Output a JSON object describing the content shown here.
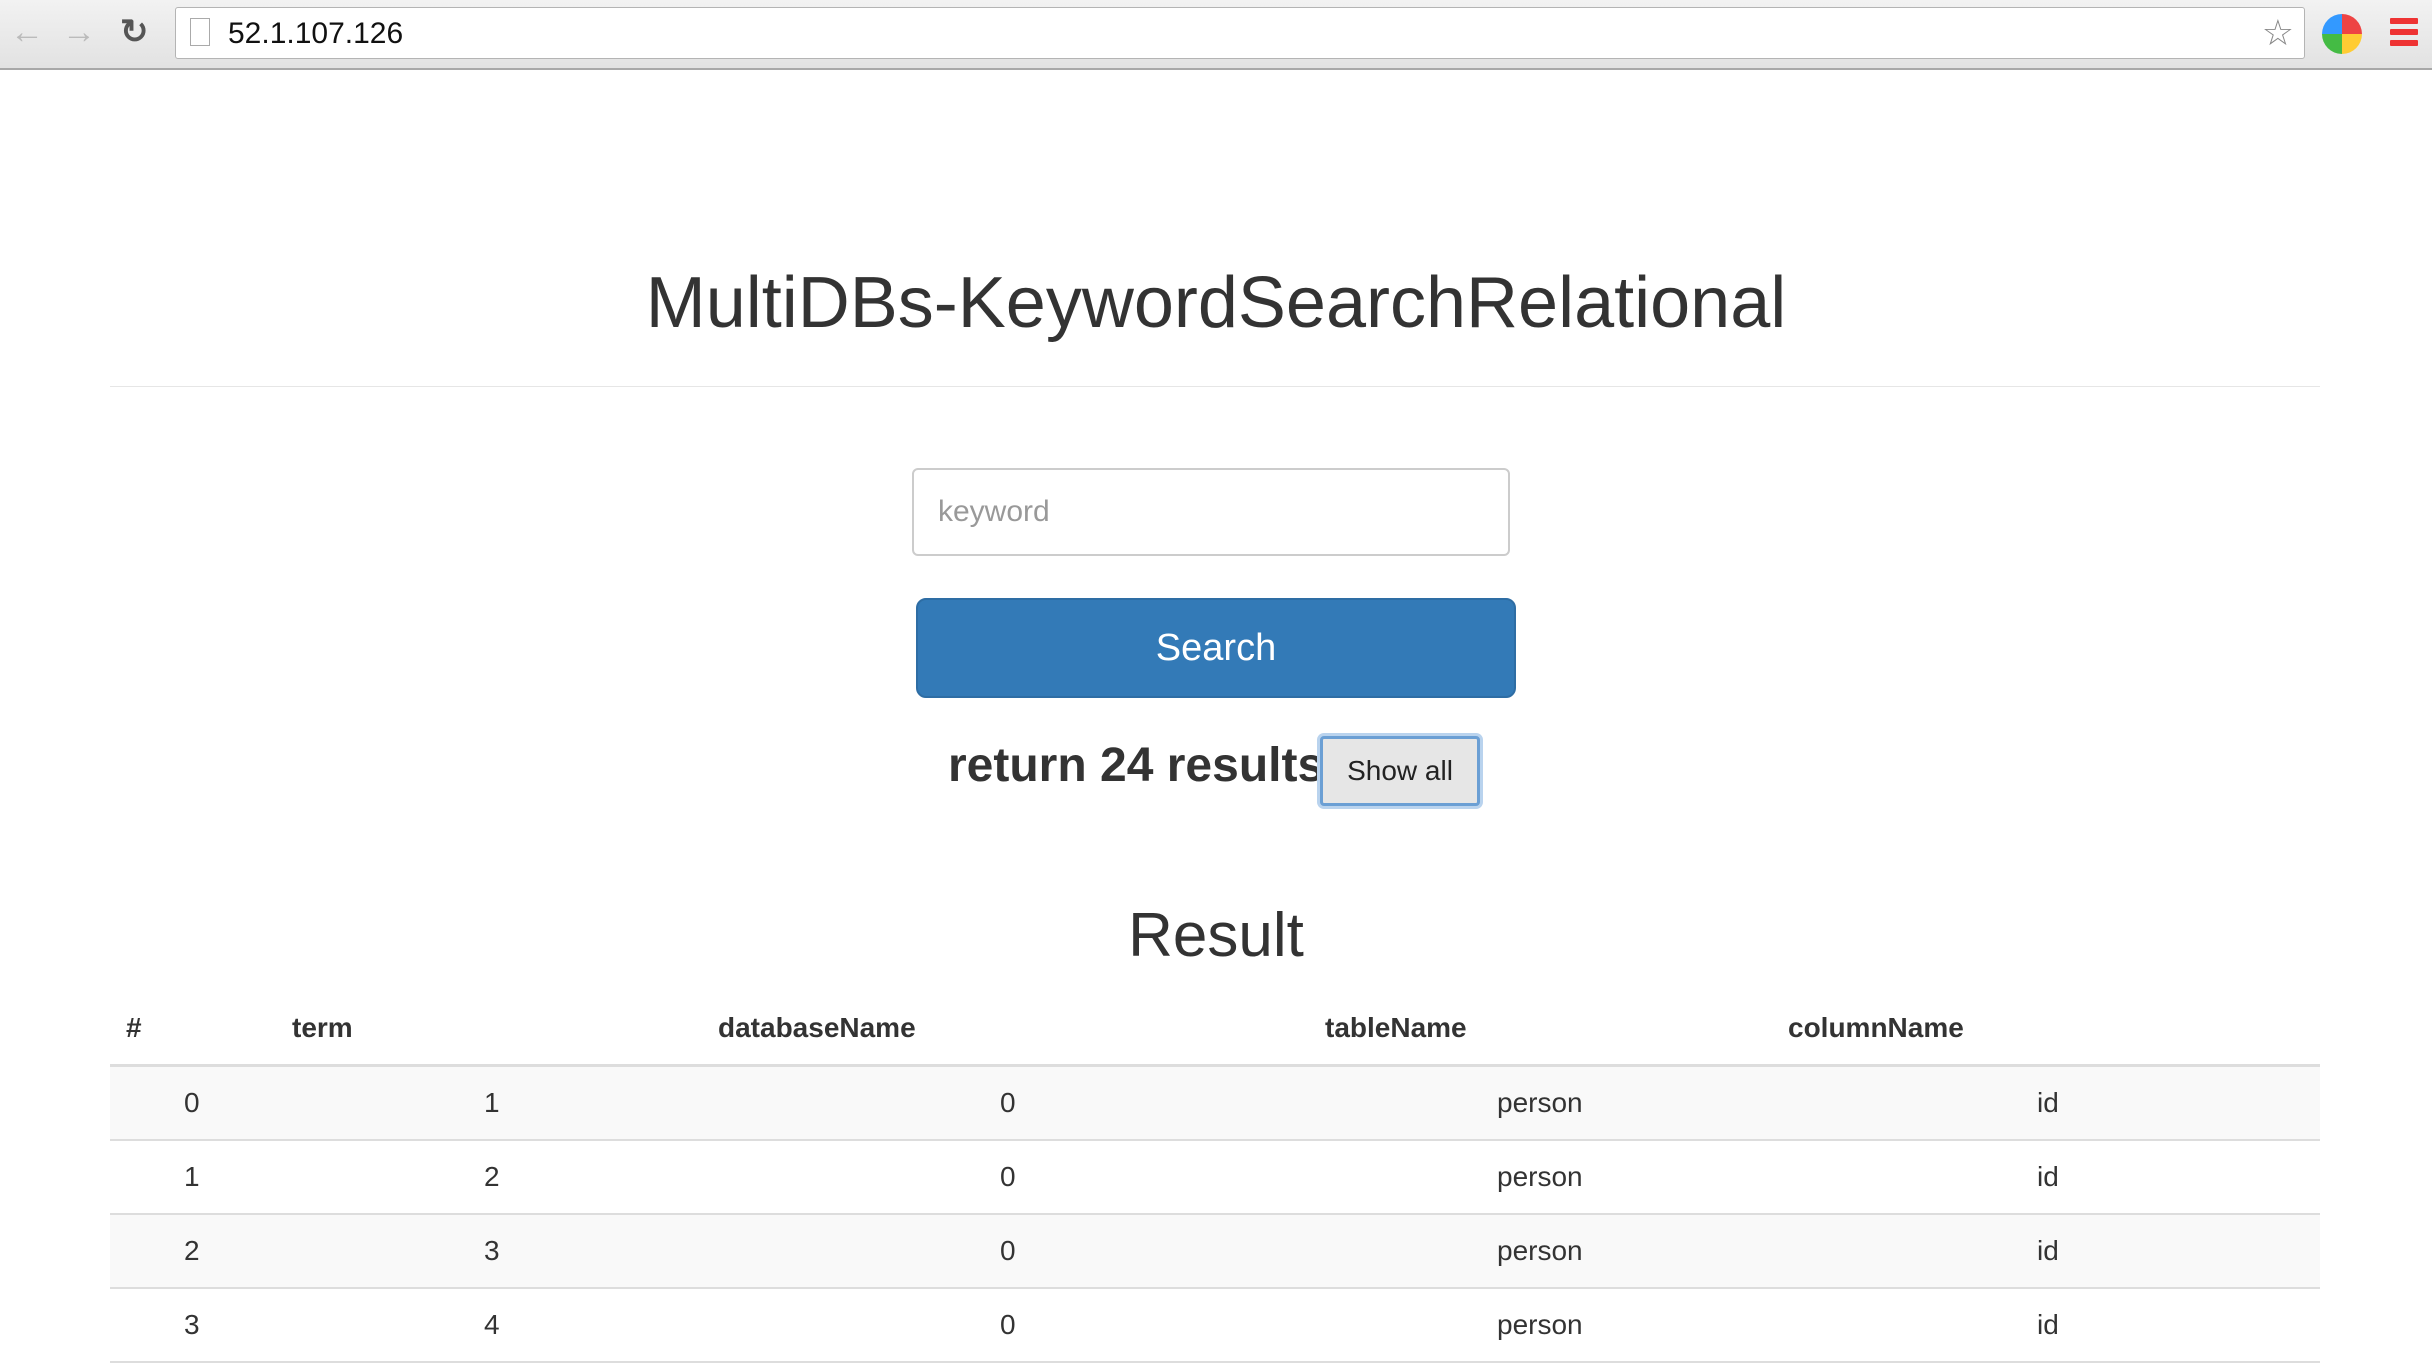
{
  "browser": {
    "url": "52.1.107.126"
  },
  "page": {
    "title": "MultiDBs-KeywordSearchRelational",
    "search_placeholder": "keyword",
    "search_button": "Search",
    "results_text": "return 24 results",
    "show_all_button": "Show all",
    "result_heading": "Result"
  },
  "table": {
    "headers": [
      "#",
      "term",
      "databaseName",
      "tableName",
      "columnName"
    ],
    "rows": [
      [
        "0",
        "1",
        "0",
        "person",
        "id"
      ],
      [
        "1",
        "2",
        "0",
        "person",
        "id"
      ],
      [
        "2",
        "3",
        "0",
        "person",
        "id"
      ],
      [
        "3",
        "4",
        "0",
        "person",
        "id"
      ]
    ]
  },
  "colors": {
    "primary": "#337ab7",
    "text": "#333333",
    "stripe": "#f9f9f9"
  }
}
